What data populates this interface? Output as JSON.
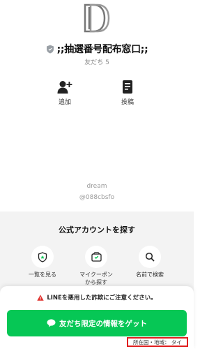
{
  "profile": {
    "logo_icon": "dd-logo-icon",
    "verified_icon": "shield-badge-icon",
    "name": ";;抽選番号配布窓口;;",
    "friends_label": "友だち 5"
  },
  "actions": [
    {
      "label": "追加",
      "icon": "add-friend-icon"
    },
    {
      "label": "投稿",
      "icon": "post-icon"
    }
  ],
  "account": {
    "name": "dream",
    "id": "@088cbsfo"
  },
  "find": {
    "title": "公式アカウントを探す",
    "items": [
      {
        "label": "一覧を見る",
        "icon": "shield-star-icon"
      },
      {
        "label": "マイクーポン\nから探す",
        "icon": "coupon-icon"
      },
      {
        "label": "名前で検索",
        "icon": "search-icon"
      }
    ]
  },
  "notice": {
    "icon": "warning-icon",
    "text": "LINEを悪用した詐欺にご注意ください。"
  },
  "cta": {
    "icon": "chat-bubble-icon",
    "label": "友だち限定の情報をゲット"
  },
  "region": {
    "label": "所在国・地域： タイ"
  },
  "colors": {
    "accent": "#06c755",
    "warning": "#e0332f",
    "highlight_border": "#e01f1f"
  }
}
